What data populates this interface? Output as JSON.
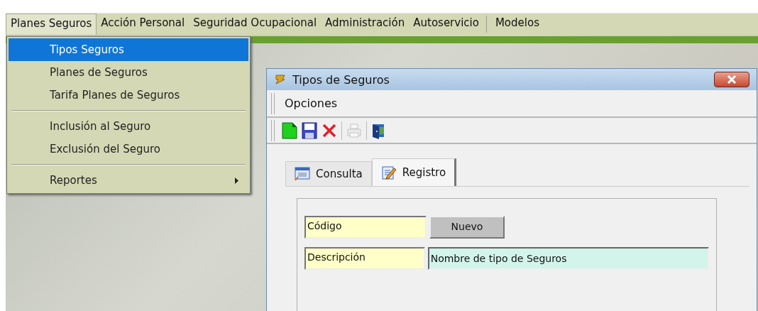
{
  "menu_bar": [
    {
      "label": "Planes Seguros",
      "selected": true
    },
    {
      "label": "Acción Personal",
      "selected": false
    },
    {
      "label": "Seguridad Ocupacional",
      "selected": false
    },
    {
      "label": "Administración",
      "selected": false
    },
    {
      "label": "Autoservicio",
      "selected": false
    },
    {
      "label": "Modelos",
      "selected": false
    }
  ],
  "dropdown": [
    {
      "label": "Tipos Seguros",
      "selected": true,
      "kind": "item"
    },
    {
      "label": "Planes de Seguros",
      "selected": false,
      "kind": "item"
    },
    {
      "label": "Tarifa Planes de Seguros",
      "selected": false,
      "kind": "item"
    },
    {
      "kind": "separator"
    },
    {
      "label": "Inclusión al Seguro",
      "selected": false,
      "kind": "item"
    },
    {
      "label": "Exclusión del Seguro",
      "selected": false,
      "kind": "item"
    },
    {
      "kind": "separator"
    },
    {
      "label": "Reportes",
      "selected": false,
      "kind": "submenu"
    }
  ],
  "window": {
    "title": "Tipos de Seguros",
    "menu": [
      "Opciones"
    ],
    "toolbar": [
      {
        "kind": "new",
        "disabled": false
      },
      {
        "kind": "save",
        "disabled": false
      },
      {
        "kind": "delete",
        "disabled": false
      },
      {
        "kind": "separator"
      },
      {
        "kind": "print",
        "disabled": true
      },
      {
        "kind": "separator"
      },
      {
        "kind": "exit",
        "disabled": false
      }
    ],
    "tabs": [
      {
        "label": "Consulta",
        "selected": false,
        "kind": "list"
      },
      {
        "label": "Registro",
        "selected": true,
        "kind": "edit"
      }
    ],
    "fields": [
      {
        "label": "Código",
        "value": "Nuevo",
        "kind": "readonly"
      },
      {
        "label": "Descripción",
        "value": "Nombre de tipo de Seguros",
        "kind": "text"
      }
    ]
  }
}
